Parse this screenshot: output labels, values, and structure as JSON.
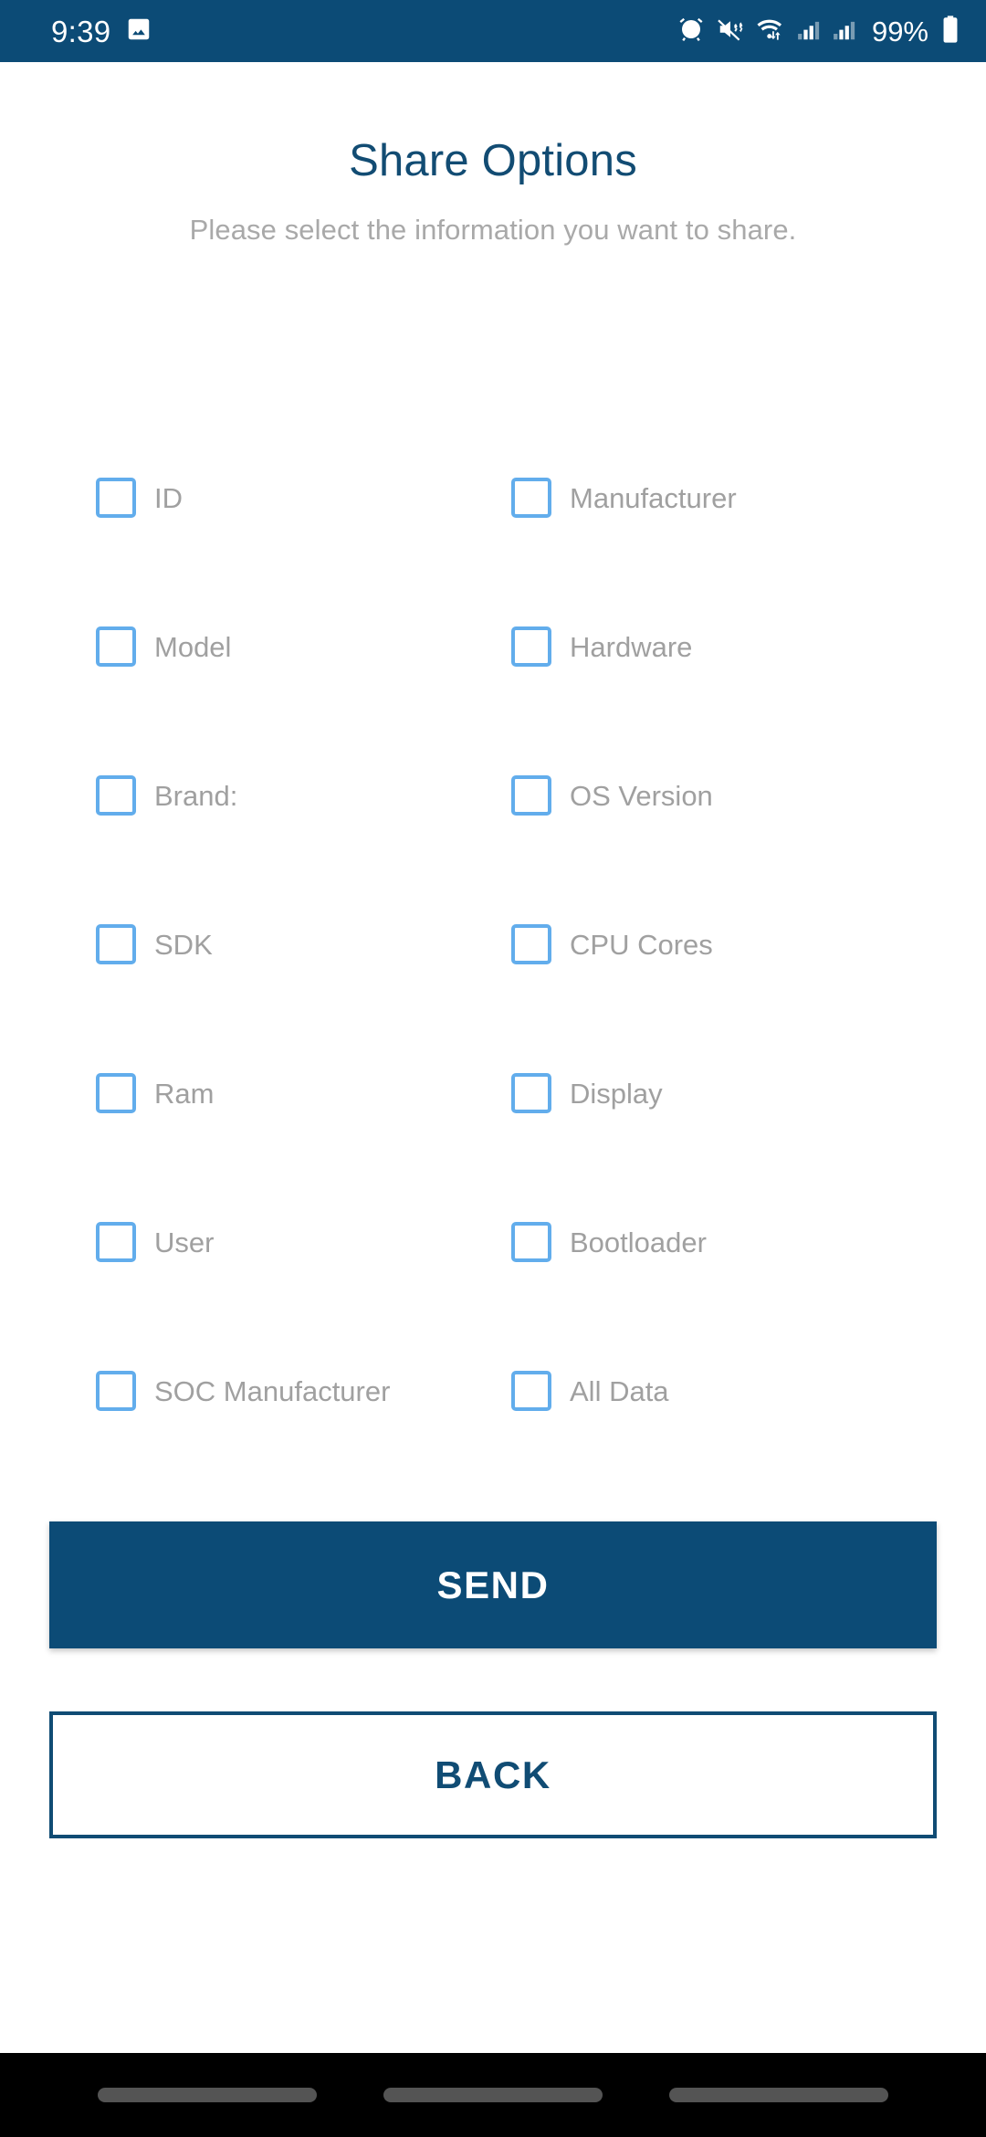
{
  "status_bar": {
    "time": "9:39",
    "battery_percent": "99%",
    "icons": [
      "photo-icon",
      "alarm-icon",
      "ringer-vibrate-off-icon",
      "wifi-data-transfer-icon",
      "signal-sim1-icon",
      "signal-sim2-icon",
      "battery-icon"
    ],
    "background_color": "#0c4b76",
    "foreground_color": "#ffffff"
  },
  "header": {
    "title": "Share Options",
    "subtitle": "Please select the information you want to share.",
    "title_color": "#124c73",
    "subtitle_color": "#a9a9a9"
  },
  "options": {
    "checkbox_border_color": "#62adec",
    "label_color": "#a0a0a0",
    "rows": [
      {
        "left": {
          "label": "ID",
          "checked": false
        },
        "right": {
          "label": "Manufacturer",
          "checked": false
        }
      },
      {
        "left": {
          "label": "Model",
          "checked": false
        },
        "right": {
          "label": "Hardware",
          "checked": false
        }
      },
      {
        "left": {
          "label": "Brand:",
          "checked": false
        },
        "right": {
          "label": "OS Version",
          "checked": false
        }
      },
      {
        "left": {
          "label": "SDK",
          "checked": false
        },
        "right": {
          "label": "CPU Cores",
          "checked": false
        }
      },
      {
        "left": {
          "label": "Ram",
          "checked": false
        },
        "right": {
          "label": "Display",
          "checked": false
        }
      },
      {
        "left": {
          "label": "User",
          "checked": false
        },
        "right": {
          "label": "Bootloader",
          "checked": false
        }
      },
      {
        "left": {
          "label": "SOC Manufacturer",
          "checked": false
        },
        "right": {
          "label": "All Data",
          "checked": false
        }
      }
    ]
  },
  "actions": {
    "send_label": "SEND",
    "back_label": "BACK",
    "primary_color": "#0c4b76",
    "outline_color": "#104c74"
  },
  "nav_bar": {
    "background_color": "#000000",
    "pill_color": "#545454",
    "items": [
      "recents-pill",
      "home-pill",
      "back-pill"
    ]
  }
}
